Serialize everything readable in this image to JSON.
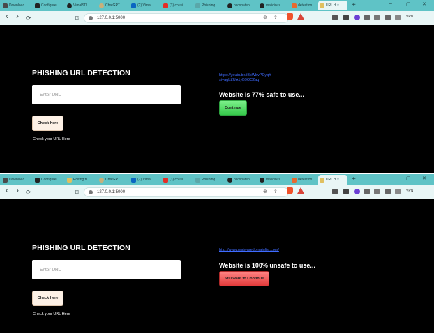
{
  "top": {
    "tabs": [
      {
        "label": "Download",
        "icon": "download-icon",
        "color": "#4a4a4a"
      },
      {
        "label": "Configure",
        "icon": "app-icon",
        "color": "#222222"
      },
      {
        "label": "VimalSD",
        "icon": "github-icon",
        "color": "#222222"
      },
      {
        "label": "ChatGPT",
        "icon": "chatgpt-icon",
        "color": "#c9b07a"
      },
      {
        "label": "(2) Vimal",
        "icon": "linkedin-icon",
        "color": "#0a66c2"
      },
      {
        "label": "(3) cousi",
        "icon": "youtube-icon",
        "color": "#e52d27"
      },
      {
        "label": "Phishing",
        "icon": "page-icon",
        "color": "#5aa7a9"
      },
      {
        "label": "pccspaten",
        "icon": "github-icon",
        "color": "#222222"
      },
      {
        "label": "malicious",
        "icon": "github-icon",
        "color": "#222222"
      },
      {
        "label": "detection",
        "icon": "page-icon",
        "color": "#e86a2e"
      },
      {
        "label": "URL d",
        "icon": "page-icon",
        "color": "#e0c060"
      }
    ],
    "url": "127.0.0.1:5000",
    "vpn": "VPN",
    "heading": "PHISHING URL DETECTION",
    "input_placeholder": "Enter URL",
    "check_button": "Check here",
    "hint": "Check your URL Here",
    "result_link_lines": [
      "https://youtu.be/iBcWbvPCyqY",
      "si=agbZUA1yB9OC2aq"
    ],
    "result_text": "Website is 77% safe to use...",
    "continue_button": "Continue"
  },
  "bottom": {
    "tabs": [
      {
        "label": "Download",
        "icon": "download-icon",
        "color": "#4a4a4a"
      },
      {
        "label": "Configure",
        "icon": "app-icon",
        "color": "#222222"
      },
      {
        "label": "Editing fr",
        "icon": "page-icon",
        "color": "#e0c060"
      },
      {
        "label": "ChatGPT",
        "icon": "chatgpt-icon",
        "color": "#c9b07a"
      },
      {
        "label": "(2) Vimal",
        "icon": "linkedin-icon",
        "color": "#0a66c2"
      },
      {
        "label": "(3) cousi",
        "icon": "youtube-icon",
        "color": "#e52d27"
      },
      {
        "label": "Phishing",
        "icon": "page-icon",
        "color": "#5aa7a9"
      },
      {
        "label": "pccspaten",
        "icon": "github-icon",
        "color": "#222222"
      },
      {
        "label": "malicious",
        "icon": "github-icon",
        "color": "#222222"
      },
      {
        "label": "detection",
        "icon": "page-icon",
        "color": "#e86a2e"
      },
      {
        "label": "URL d",
        "icon": "page-icon",
        "color": "#e0c060"
      }
    ],
    "url": "127.0.0.1:5000",
    "vpn": "VPN",
    "heading": "PHISHING URL DETECTION",
    "input_placeholder": "Enter URL",
    "check_button": "Check here",
    "hint": "Check your URL Here",
    "result_link_lines": [
      "http://www.malwaredomainlist.com/"
    ],
    "result_text": "Website is 100% unsafe to use...",
    "continue_button": "Still want to Continue"
  },
  "icons": {
    "back": "‹",
    "forward": "›",
    "reload": "⟳",
    "bookmark": "⌑",
    "zoom": "⊕",
    "share": "⇪",
    "new_tab": "+",
    "minimize": "–",
    "maximize": "▢",
    "close": "✕",
    "tab_close": "×"
  }
}
